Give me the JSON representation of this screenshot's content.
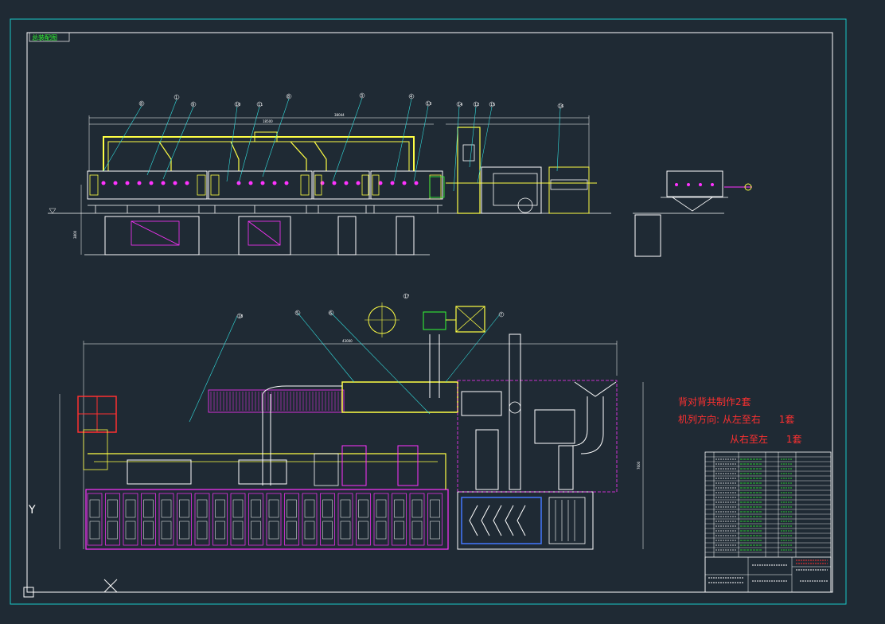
{
  "drawing": {
    "frame_tag": "总装配图",
    "background_color": "#1f2a34",
    "notes": {
      "line1": "背对背共制作2套",
      "line2": "机列方向: 从左至右      1套",
      "line3": "从右至左      1套",
      "color": "#ff3030"
    },
    "balloons_elevation": [
      "8",
      "1",
      "9",
      "10",
      "11",
      "8",
      "3",
      "4",
      "13",
      "14",
      "12",
      "15",
      "16"
    ],
    "balloons_plan": [
      "18",
      "5",
      "6",
      "17",
      "7"
    ],
    "dims": {
      "overall_top": "38044",
      "overall_mid": "18500",
      "overall_plan": "43000",
      "plan_height": "7600",
      "elev_height": "3800"
    },
    "ucs_y_label": "Y",
    "parts_table_rows": 22
  },
  "colors": {
    "frame": "#ffffff",
    "border": "#19c8c8",
    "equipment_main": "#ffffff",
    "magenta": "#ff33ff",
    "yellow": "#ffff44",
    "cyan": "#33e0e0",
    "green": "#33ff33",
    "red": "#ff3030",
    "blue": "#4477ff"
  }
}
